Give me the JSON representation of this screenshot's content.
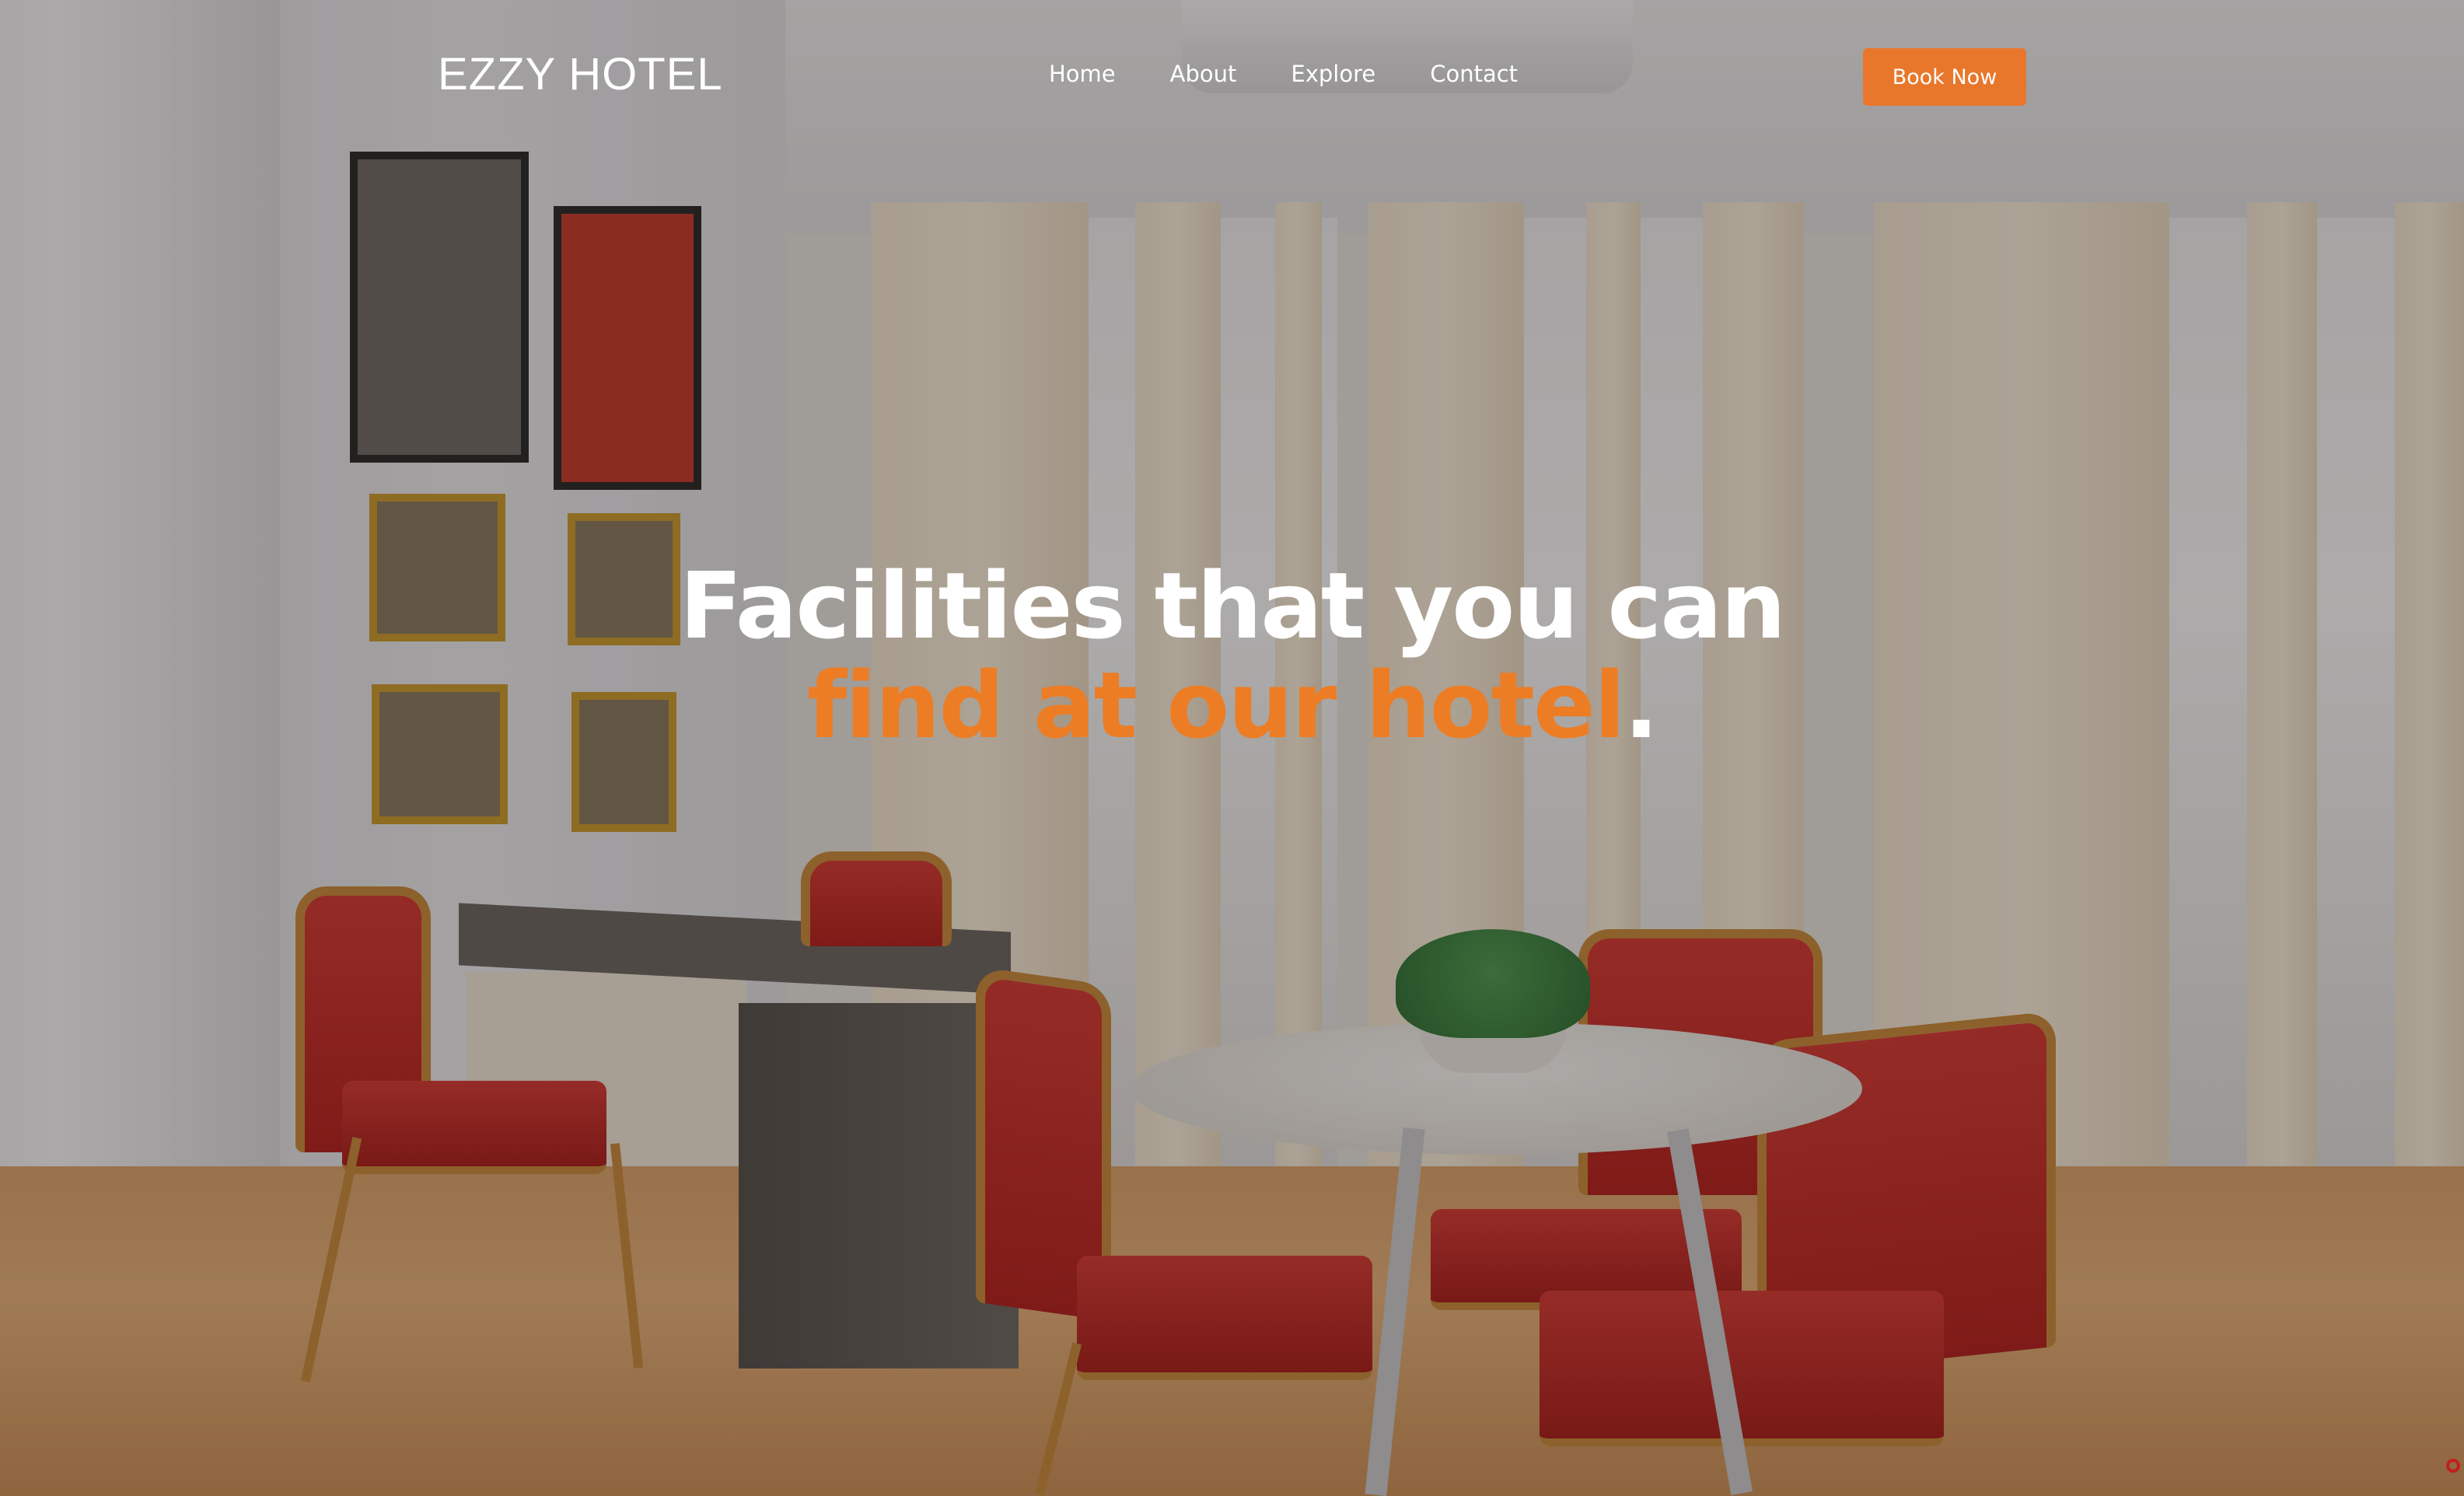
{
  "brand": {
    "name": "EZZY HOTEL"
  },
  "nav": {
    "items": [
      {
        "label": "Home"
      },
      {
        "label": "About"
      },
      {
        "label": "Explore"
      },
      {
        "label": "Contact"
      }
    ],
    "cta_label": "Book Now"
  },
  "hero": {
    "line1": "Facilities that you can",
    "line2_accent": "find at our hotel",
    "line2_end": "."
  },
  "colors": {
    "accent": "#e8772b",
    "text": "#ffffff"
  },
  "icons": {
    "corner": "record-icon"
  }
}
